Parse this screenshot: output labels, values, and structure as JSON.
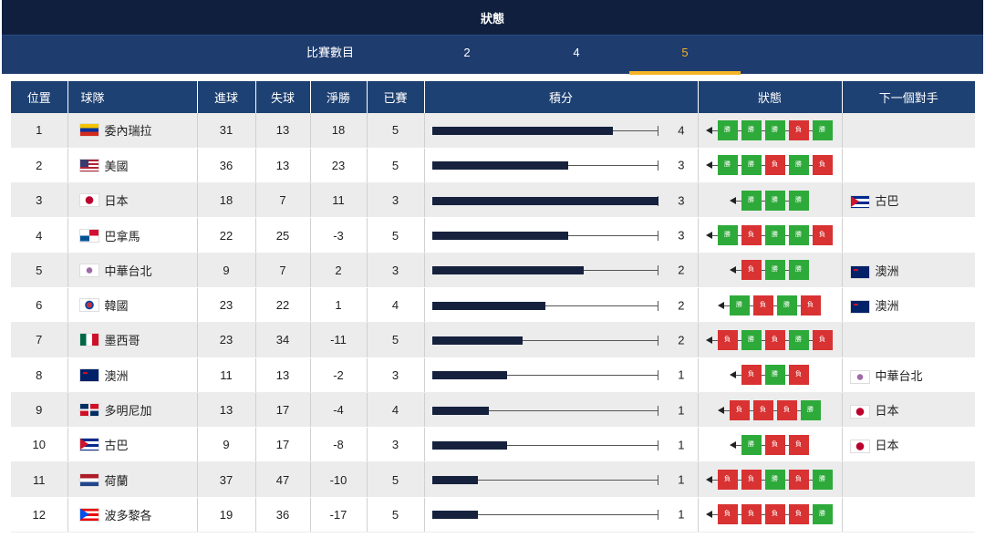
{
  "header": {
    "title": "狀態"
  },
  "tabs": {
    "label": "比賽數目",
    "items": [
      "2",
      "4",
      "5"
    ],
    "active": "5"
  },
  "columns": [
    "位置",
    "球隊",
    "進球",
    "失球",
    "淨勝",
    "已賽",
    "積分",
    "狀態",
    "下一個對手"
  ],
  "max_points": 3,
  "win_label": "勝",
  "loss_label": "負",
  "colors": {
    "win": "#2eaa3a",
    "loss": "#d93232",
    "header": "#1e4173",
    "active_tab": "#f5b325"
  },
  "rows": [
    {
      "pos": "1",
      "team": "委內瑞拉",
      "flag": "ven",
      "gf": "31",
      "ga": "13",
      "gd": "18",
      "played": "5",
      "pts": "4",
      "fill": 0.8,
      "form": [
        "勝",
        "勝",
        "勝",
        "負",
        "勝"
      ],
      "next": "",
      "next_flag": ""
    },
    {
      "pos": "2",
      "team": "美國",
      "flag": "usa",
      "gf": "36",
      "ga": "13",
      "gd": "23",
      "played": "5",
      "pts": "3",
      "fill": 0.6,
      "form": [
        "勝",
        "勝",
        "負",
        "勝",
        "負"
      ],
      "next": "",
      "next_flag": ""
    },
    {
      "pos": "3",
      "team": "日本",
      "flag": "jpn",
      "gf": "18",
      "ga": "7",
      "gd": "11",
      "played": "3",
      "pts": "3",
      "fill": 1.0,
      "form": [
        "勝",
        "勝",
        "勝"
      ],
      "next": "古巴",
      "next_flag": "cub"
    },
    {
      "pos": "4",
      "team": "巴拿馬",
      "flag": "pan",
      "gf": "22",
      "ga": "25",
      "gd": "-3",
      "played": "5",
      "pts": "3",
      "fill": 0.6,
      "form": [
        "勝",
        "負",
        "勝",
        "勝",
        "負"
      ],
      "next": "",
      "next_flag": ""
    },
    {
      "pos": "5",
      "team": "中華台北",
      "flag": "tpe",
      "gf": "9",
      "ga": "7",
      "gd": "2",
      "played": "3",
      "pts": "2",
      "fill": 0.67,
      "form": [
        "負",
        "勝",
        "勝"
      ],
      "next": "澳洲",
      "next_flag": "aus"
    },
    {
      "pos": "6",
      "team": "韓國",
      "flag": "kor",
      "gf": "23",
      "ga": "22",
      "gd": "1",
      "played": "4",
      "pts": "2",
      "fill": 0.5,
      "form": [
        "勝",
        "負",
        "勝",
        "負"
      ],
      "next": "澳洲",
      "next_flag": "aus"
    },
    {
      "pos": "7",
      "team": "墨西哥",
      "flag": "mex",
      "gf": "23",
      "ga": "34",
      "gd": "-11",
      "played": "5",
      "pts": "2",
      "fill": 0.4,
      "form": [
        "負",
        "勝",
        "負",
        "勝",
        "負"
      ],
      "next": "",
      "next_flag": ""
    },
    {
      "pos": "8",
      "team": "澳洲",
      "flag": "aus",
      "gf": "11",
      "ga": "13",
      "gd": "-2",
      "played": "3",
      "pts": "1",
      "fill": 0.33,
      "form": [
        "負",
        "勝",
        "負"
      ],
      "next": "中華台北",
      "next_flag": "tpe"
    },
    {
      "pos": "9",
      "team": "多明尼加",
      "flag": "dom",
      "gf": "13",
      "ga": "17",
      "gd": "-4",
      "played": "4",
      "pts": "1",
      "fill": 0.25,
      "form": [
        "負",
        "負",
        "負",
        "勝"
      ],
      "next": "日本",
      "next_flag": "jpn"
    },
    {
      "pos": "10",
      "team": "古巴",
      "flag": "cub",
      "gf": "9",
      "ga": "17",
      "gd": "-8",
      "played": "3",
      "pts": "1",
      "fill": 0.33,
      "form": [
        "勝",
        "負",
        "負"
      ],
      "next": "日本",
      "next_flag": "jpn"
    },
    {
      "pos": "11",
      "team": "荷蘭",
      "flag": "ned",
      "gf": "37",
      "ga": "47",
      "gd": "-10",
      "played": "5",
      "pts": "1",
      "fill": 0.2,
      "form": [
        "負",
        "負",
        "勝",
        "負",
        "勝"
      ],
      "next": "",
      "next_flag": ""
    },
    {
      "pos": "12",
      "team": "波多黎各",
      "flag": "pur",
      "gf": "19",
      "ga": "36",
      "gd": "-17",
      "played": "5",
      "pts": "1",
      "fill": 0.2,
      "form": [
        "負",
        "負",
        "負",
        "負",
        "勝"
      ],
      "next": "",
      "next_flag": ""
    }
  ]
}
